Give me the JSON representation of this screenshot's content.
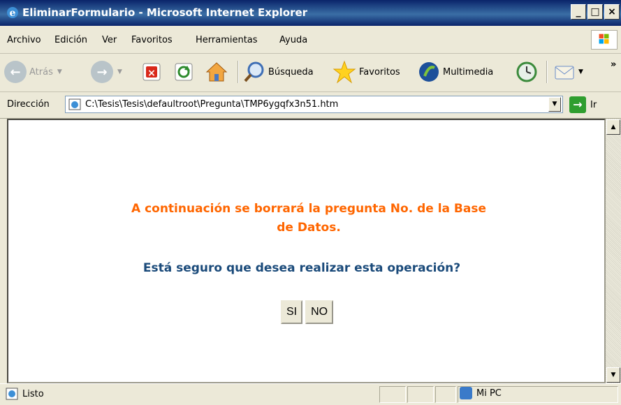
{
  "window": {
    "title": "EliminarFormulario - Microsoft Internet Explorer",
    "minimize_label": "_",
    "maximize_label": "□",
    "close_label": "×"
  },
  "menu": {
    "items": [
      "Archivo",
      "Edición",
      "Ver",
      "Favoritos",
      "Herramientas",
      "Ayuda"
    ]
  },
  "toolbar": {
    "back_label": "Atrás",
    "search_label": "Búsqueda",
    "favorites_label": "Favoritos",
    "media_label": "Multimedia",
    "chevron": "»"
  },
  "address": {
    "label": "Dirección",
    "value": "C:\\Tesis\\Tesis\\defaultroot\\Pregunta\\TMP6ygqfx3n51.htm",
    "go_label": "Ir"
  },
  "page": {
    "message_line1": "A continuación se borrará la pregunta No. de la Base",
    "message_line2": "de Datos.",
    "question": "Está seguro que desea realizar esta operación?",
    "yes_label": "SI",
    "no_label": "NO",
    "message_color": "#ff6600",
    "question_color": "#1a4a7a"
  },
  "status": {
    "text": "Listo",
    "zone": "Mi PC"
  }
}
